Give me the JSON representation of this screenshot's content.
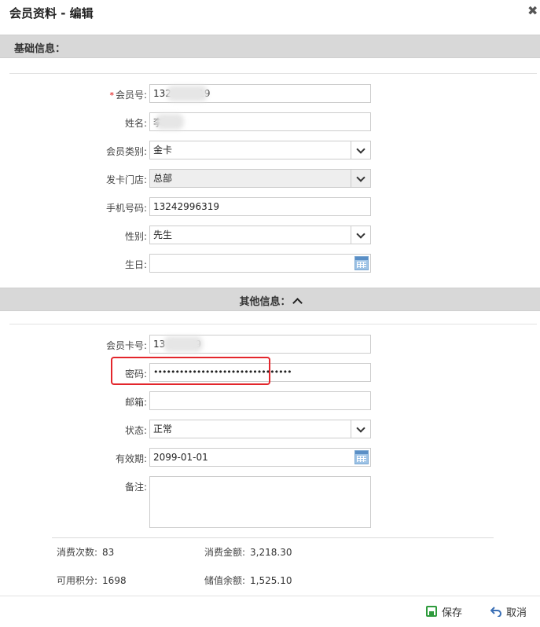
{
  "dialog": {
    "title": "会员资料 - 编辑",
    "close": "✖"
  },
  "sections": {
    "basic": "基础信息：",
    "other": "其他信息："
  },
  "basic_fields": {
    "member_no": {
      "label": "会员号:",
      "value": "132         19"
    },
    "name": {
      "label": "姓名:",
      "value": "李"
    },
    "member_type": {
      "label": "会员类别:",
      "value": "金卡"
    },
    "store": {
      "label": "发卡门店:",
      "value": "总部"
    },
    "mobile": {
      "label": "手机号码:",
      "value": "13242996319"
    },
    "gender": {
      "label": "性别:",
      "value": "先生"
    },
    "birthday": {
      "label": "生日:",
      "value": ""
    }
  },
  "other_fields": {
    "card_no": {
      "label": "会员卡号:",
      "value": "13          9"
    },
    "password": {
      "label": "密码:",
      "value": "••••••••••••••••••••••••••••••••"
    },
    "email": {
      "label": "邮箱:",
      "value": ""
    },
    "status": {
      "label": "状态:",
      "value": "正常"
    },
    "expiry": {
      "label": "有效期:",
      "value": "2099-01-01"
    },
    "remark": {
      "label": "备注:",
      "value": ""
    }
  },
  "stats": {
    "consume_count_label": "消费次数:",
    "consume_count": "83",
    "consume_amount_label": "消费金额:",
    "consume_amount": "3,218.30",
    "points_label": "可用积分:",
    "points": "1698",
    "balance_label": "储值余额:",
    "balance": "1,525.10"
  },
  "footer": {
    "save": "保存",
    "cancel": "取消"
  },
  "colors": {
    "section_bg": "#d8d8d8",
    "highlight": "#e3262c",
    "save_icon": "#2e9b3c",
    "cancel_icon": "#3a6fb5",
    "calendar_icon": "#9ec3e6"
  }
}
